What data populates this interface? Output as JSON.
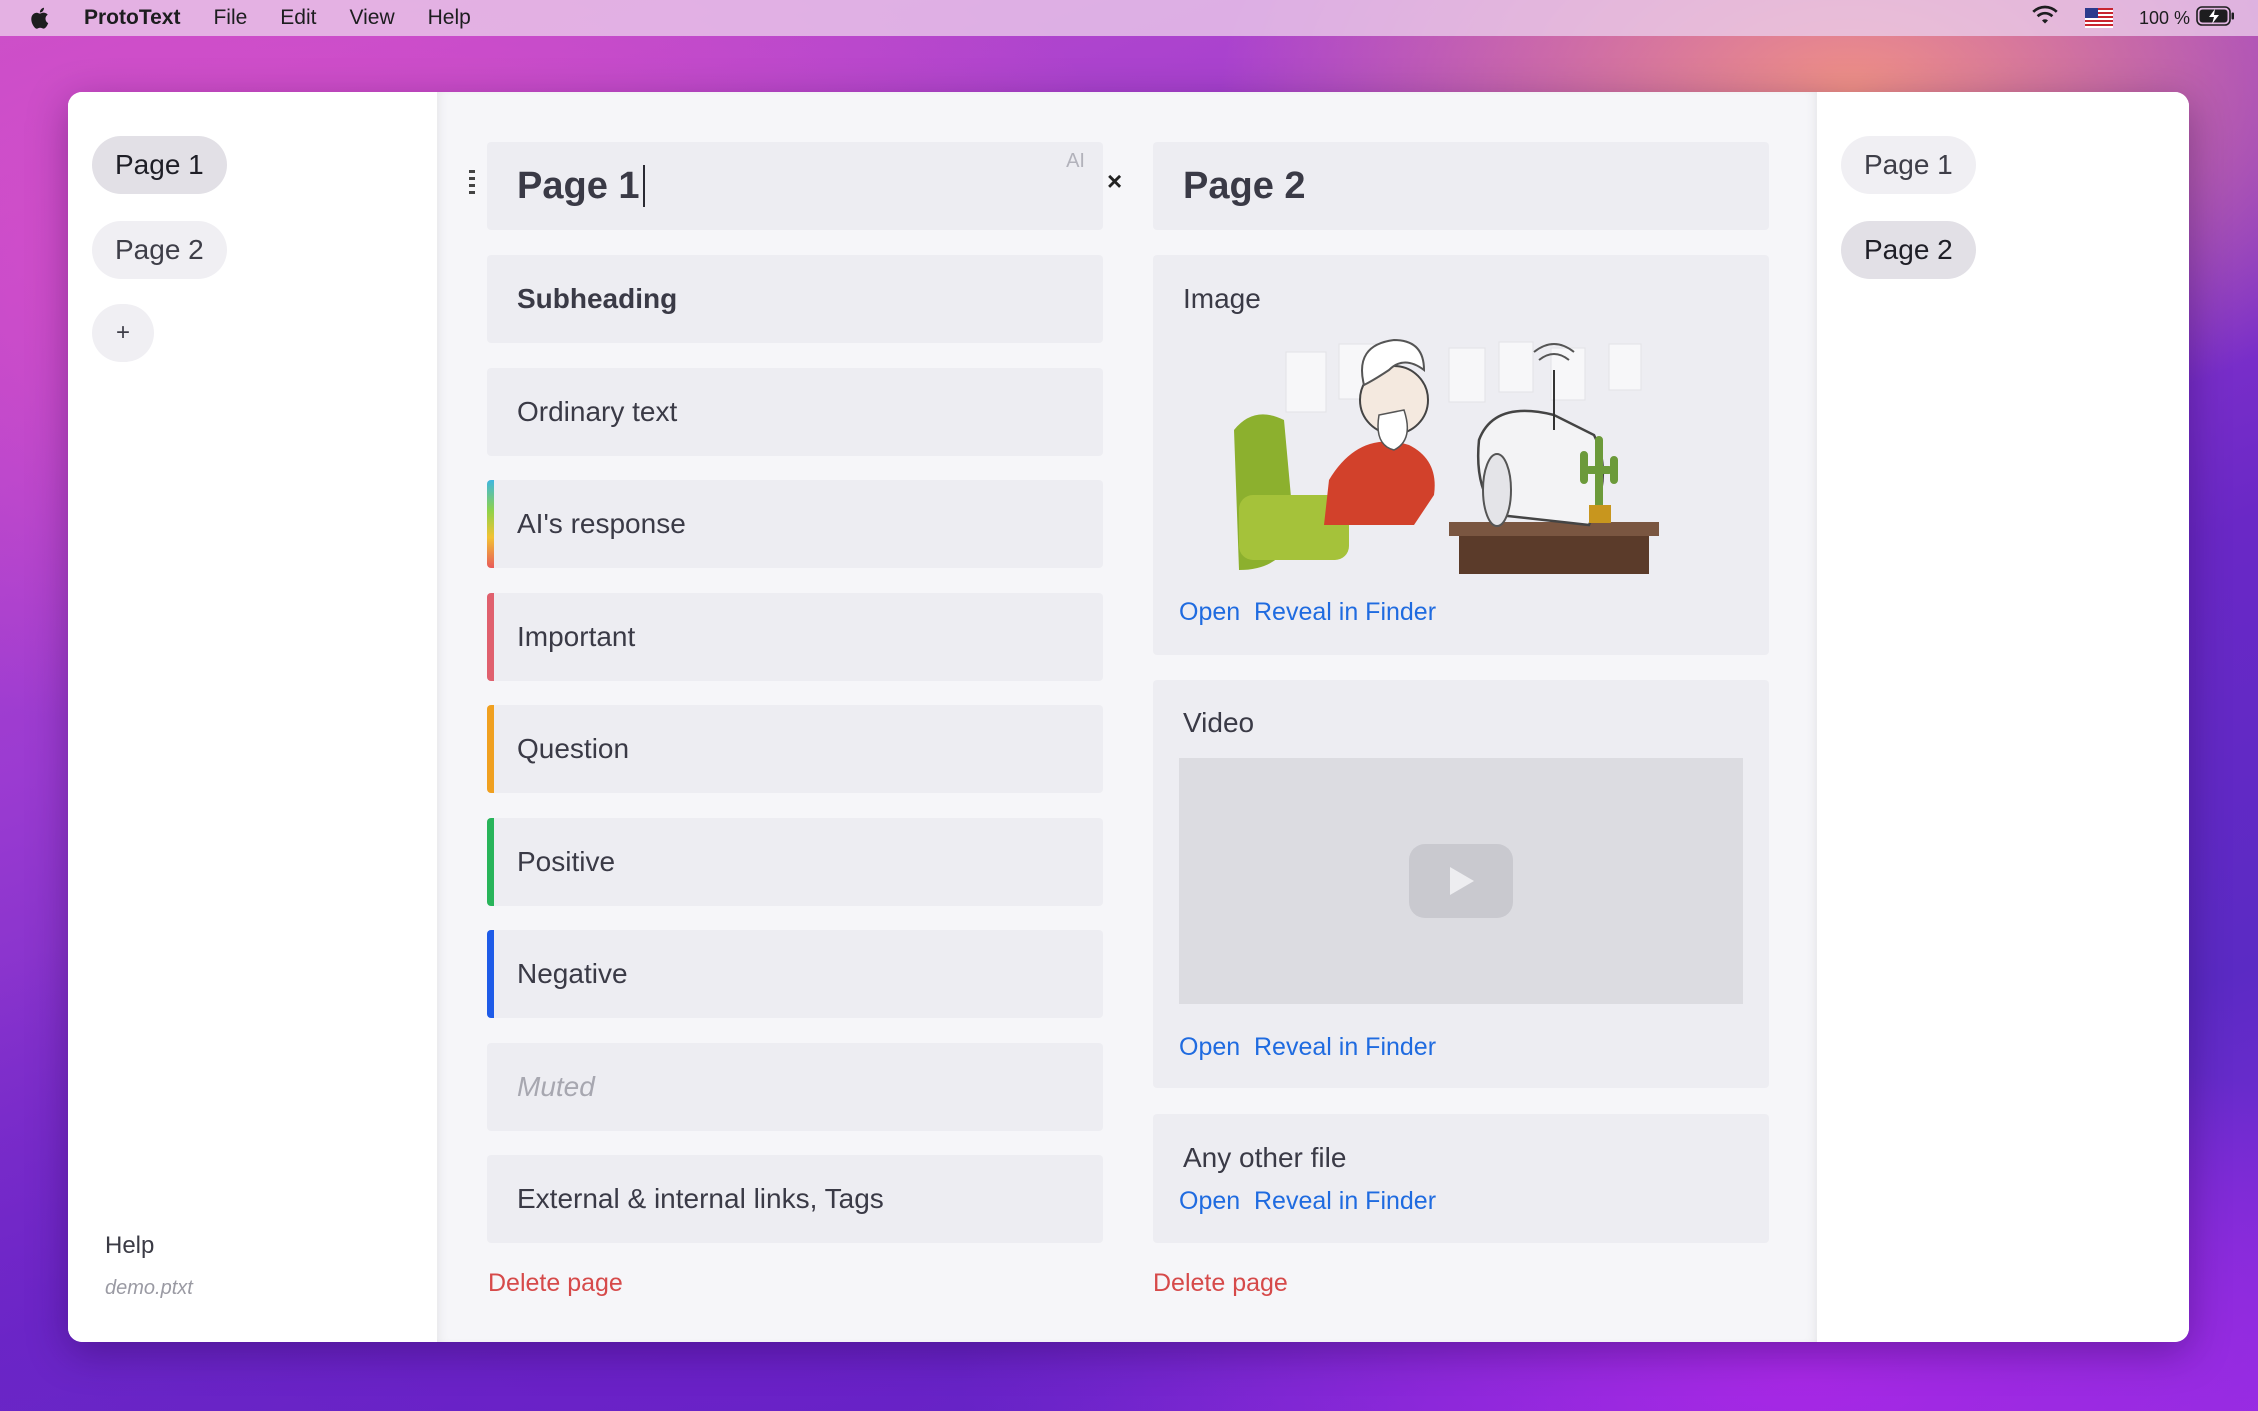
{
  "menubar": {
    "app_name": "ProtoText",
    "items": [
      "File",
      "Edit",
      "View",
      "Help"
    ],
    "battery": "100 %",
    "icons": [
      "apple-icon",
      "wifi-icon",
      "us-flag-icon",
      "battery-charging-icon"
    ]
  },
  "left_sidebar": {
    "pages": [
      {
        "label": "Page 1",
        "active": true
      },
      {
        "label": "Page 2",
        "active": false
      }
    ],
    "add_label": "+",
    "help_label": "Help",
    "file_name": "demo.ptxt"
  },
  "right_sidebar": {
    "pages": [
      {
        "label": "Page 1",
        "active": false
      },
      {
        "label": "Page 2",
        "active": true
      }
    ]
  },
  "page1": {
    "title": "Page 1",
    "ai_label": "AI",
    "blocks": [
      {
        "text": "Subheading",
        "style": "subheading"
      },
      {
        "text": "Ordinary text",
        "style": "normal"
      },
      {
        "text": "AI's response",
        "style": "ai",
        "color": "gradient"
      },
      {
        "text": "Important",
        "style": "important",
        "color": "#e0606e"
      },
      {
        "text": "Question",
        "style": "question",
        "color": "#f0a020"
      },
      {
        "text": "Positive",
        "style": "positive",
        "color": "#28b45a"
      },
      {
        "text": "Negative",
        "style": "negative",
        "color": "#1e5be8"
      },
      {
        "text": "Muted",
        "style": "muted"
      },
      {
        "text": "External & internal links, Tags",
        "style": "normal"
      }
    ],
    "delete_label": "Delete page"
  },
  "page2": {
    "title": "Page 2",
    "close_label": "×",
    "image_card": {
      "label": "Image",
      "open": "Open",
      "reveal": "Reveal in Finder"
    },
    "video_card": {
      "label": "Video",
      "open": "Open",
      "reveal": "Reveal in Finder"
    },
    "file_card": {
      "label": "Any other file",
      "open": "Open",
      "reveal": "Reveal in Finder"
    },
    "delete_label": "Delete page"
  },
  "colors": {
    "link": "#1f6be0",
    "delete": "#d64a4a",
    "card_bg": "#ededf2"
  }
}
